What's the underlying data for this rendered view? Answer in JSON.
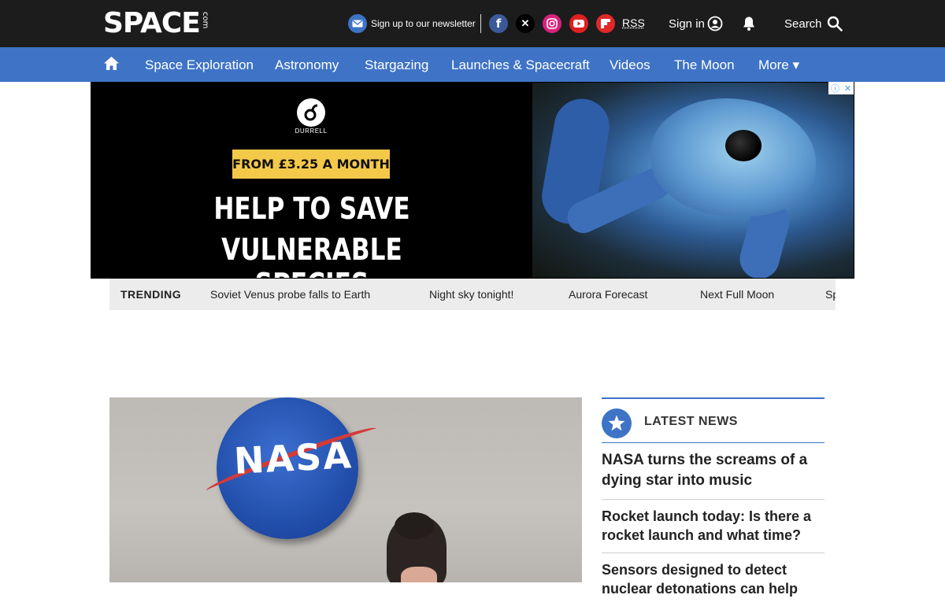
{
  "header": {
    "logo_main": "SPACE",
    "logo_suffix": "com",
    "newsletter_label": "Sign up to our newsletter",
    "rss_label": "RSS",
    "signin_label": "Sign in",
    "search_label": "Search",
    "social": [
      {
        "name": "facebook",
        "glyph": "f",
        "color": "#3b5998"
      },
      {
        "name": "x",
        "glyph": "𝕏",
        "color": "#000000"
      },
      {
        "name": "instagram",
        "glyph": "◎",
        "color": "#d6247b"
      },
      {
        "name": "youtube",
        "glyph": "▶",
        "color": "#e0201f"
      },
      {
        "name": "flipboard",
        "glyph": "f",
        "color": "#e12828"
      }
    ]
  },
  "nav": {
    "items": [
      "Space Exploration",
      "Astronomy",
      "Stargazing",
      "Launches & Spacecraft",
      "Videos",
      "The Moon",
      "More ▾"
    ]
  },
  "ad": {
    "brand": "DURRELL",
    "price": "FROM £3.25 A MONTH",
    "headline_1": "HELP TO SAVE",
    "headline_2": "VULNERABLE SPECIES"
  },
  "trending": {
    "label": "TRENDING",
    "items": [
      "Soviet Venus probe falls to Earth",
      "Night sky tonight!",
      "Aurora Forecast",
      "Next Full Moon",
      "Sp"
    ]
  },
  "hero": {
    "logo_text": "NASA"
  },
  "latest": {
    "title": "LATEST NEWS",
    "items": [
      "NASA turns the screams of a dying star into music",
      "Rocket launch today: Is there a rocket launch and what time?",
      "Sensors designed to detect nuclear detonations can help"
    ]
  },
  "colors": {
    "topbar": "#1c1c1c",
    "brand_blue": "#3e73c6",
    "trending_bg": "#ececec",
    "ad_yellow": "#f4c94a"
  }
}
